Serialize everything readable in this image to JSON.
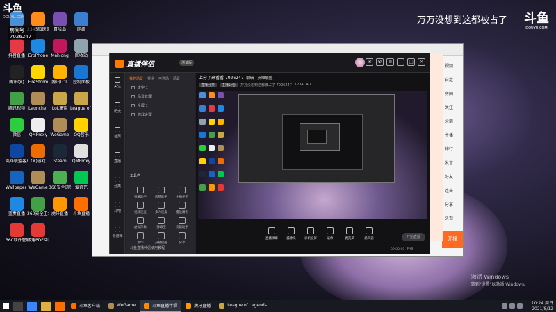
{
  "overlay": {
    "logo_text": "斗鱼",
    "logo_sub": "DOUYU.COM",
    "room_label": "房间号",
    "room_number": "7026247",
    "caption": "万万没想到这都被占了",
    "right_logo": "斗鱼",
    "right_logo_sub": "DOUYU.COM"
  },
  "desktop_icons": [
    {
      "label": "此电脑",
      "color": "#4a90d9"
    },
    {
      "label": "2345加速浏览器",
      "color": "#ff8c1a"
    },
    {
      "label": "冒险岛",
      "color": "#7a4fb2"
    },
    {
      "label": "网络",
      "color": "#3c7fd0"
    },
    {
      "label": "抖音直播",
      "color": "#e63946"
    },
    {
      "label": "EroPhone",
      "color": "#1e88e5"
    },
    {
      "label": "Mahjong",
      "color": "#c2185b"
    },
    {
      "label": "回收站",
      "color": "#90a4ae"
    },
    {
      "label": "腾讯QQ",
      "color": "#222"
    },
    {
      "label": "FireStorm",
      "color": "#ffd600"
    },
    {
      "label": "腾讯LOL",
      "color": "#ffb300"
    },
    {
      "label": "控制面板",
      "color": "#1976d2"
    },
    {
      "label": "腾讯视频",
      "color": "#43a047"
    },
    {
      "label": "Launcher",
      "color": "#b08d57"
    },
    {
      "label": "LoL掌盟",
      "color": "#c9a64a"
    },
    {
      "label": "League of Legends",
      "color": "#c9a64a"
    },
    {
      "label": "微信",
      "color": "#2ecc40"
    },
    {
      "label": "QMProxy",
      "color": "#eeeeee"
    },
    {
      "label": "WeGame",
      "color": "#b08d57"
    },
    {
      "label": "QQ音乐",
      "color": "#ffd200"
    },
    {
      "label": "英雄联盟客户端",
      "color": "#0d47a1"
    },
    {
      "label": "QQ游戏",
      "color": "#ef6c00"
    },
    {
      "label": "Steam",
      "color": "#1b2838"
    },
    {
      "label": "QMProxy",
      "color": "#e0e0e0"
    },
    {
      "label": "Wallpaper Engine",
      "color": "#1565c0"
    },
    {
      "label": "WeGame",
      "color": "#b08d57"
    },
    {
      "label": "360安全浏览器",
      "color": "#4caf50"
    },
    {
      "label": "爱奇艺",
      "color": "#00c853"
    },
    {
      "label": "蓝奏直播",
      "color": "#1e88e5"
    },
    {
      "label": "360安全卫士",
      "color": "#43a047"
    },
    {
      "label": "虎牙直播",
      "color": "#ff9800"
    },
    {
      "label": "斗鱼直播",
      "color": "#ff6f00"
    },
    {
      "label": "360软件管家",
      "color": "#e53935"
    },
    {
      "label": "极速PDF阅读器",
      "color": "#e53935"
    }
  ],
  "app": {
    "title": "直播伴侣",
    "badge": "测试版",
    "rail": [
      "关注",
      "历史",
      "首页",
      "直播",
      "分类",
      "斗吧",
      "云游戏"
    ],
    "tabs": [
      "我的场景",
      "贸易",
      "可选场",
      "场景"
    ],
    "scenes": [
      "文字 1",
      "场景管理",
      "全屏 1",
      "游戏设置"
    ],
    "tools_title": "工具栏",
    "tools": [
      "弹幕助手",
      "房管助手",
      "主播任务",
      "视频连麦",
      "多人连麦",
      "播放精彩",
      "虚拟形象",
      "弹幕宝",
      "贡献助手",
      "水印",
      "开播提醒",
      "分享"
    ],
    "bottom_tip": "斗鱼直播伴侣使用教程",
    "stream_title": "上分了来看看 7026247",
    "edit_label": "编辑",
    "category": "英雄联盟",
    "chips": [
      "直播分类",
      "主播公告"
    ],
    "notice": "万万没想到这都被占了 7026247",
    "counts": [
      "1234",
      "40"
    ],
    "toolbar": [
      "直播弹幕",
      "摄像头",
      "手机投屏",
      "录像",
      "麦克风",
      "扬声器"
    ],
    "start_label": "开始直播",
    "time_text": "00:00:00",
    "status_text": "开播"
  },
  "bg_window": {
    "side_texts": [
      "视频",
      "自定",
      "房间",
      "关注",
      "火箭",
      "主播",
      "排行",
      "发言",
      "好友",
      "连击",
      "分享",
      "头衔"
    ],
    "orange_label": "开播"
  },
  "taskbar": {
    "tasks": [
      {
        "label": "斗鱼客户端",
        "color": "#ff6f00",
        "active": false
      },
      {
        "label": "WeGame",
        "color": "#b08d57",
        "active": false
      },
      {
        "label": "斗鱼直播伴侣",
        "color": "#ff8a00",
        "active": true
      },
      {
        "label": "虎牙直播",
        "color": "#ff9800",
        "active": false
      },
      {
        "label": "League of Legends",
        "color": "#c9a64a",
        "active": false
      }
    ],
    "time": "10:24 周日",
    "date": "2021/8/12"
  },
  "activation": {
    "title": "激活 Windows",
    "sub": "转到\"设置\"以激活 Windows。"
  }
}
